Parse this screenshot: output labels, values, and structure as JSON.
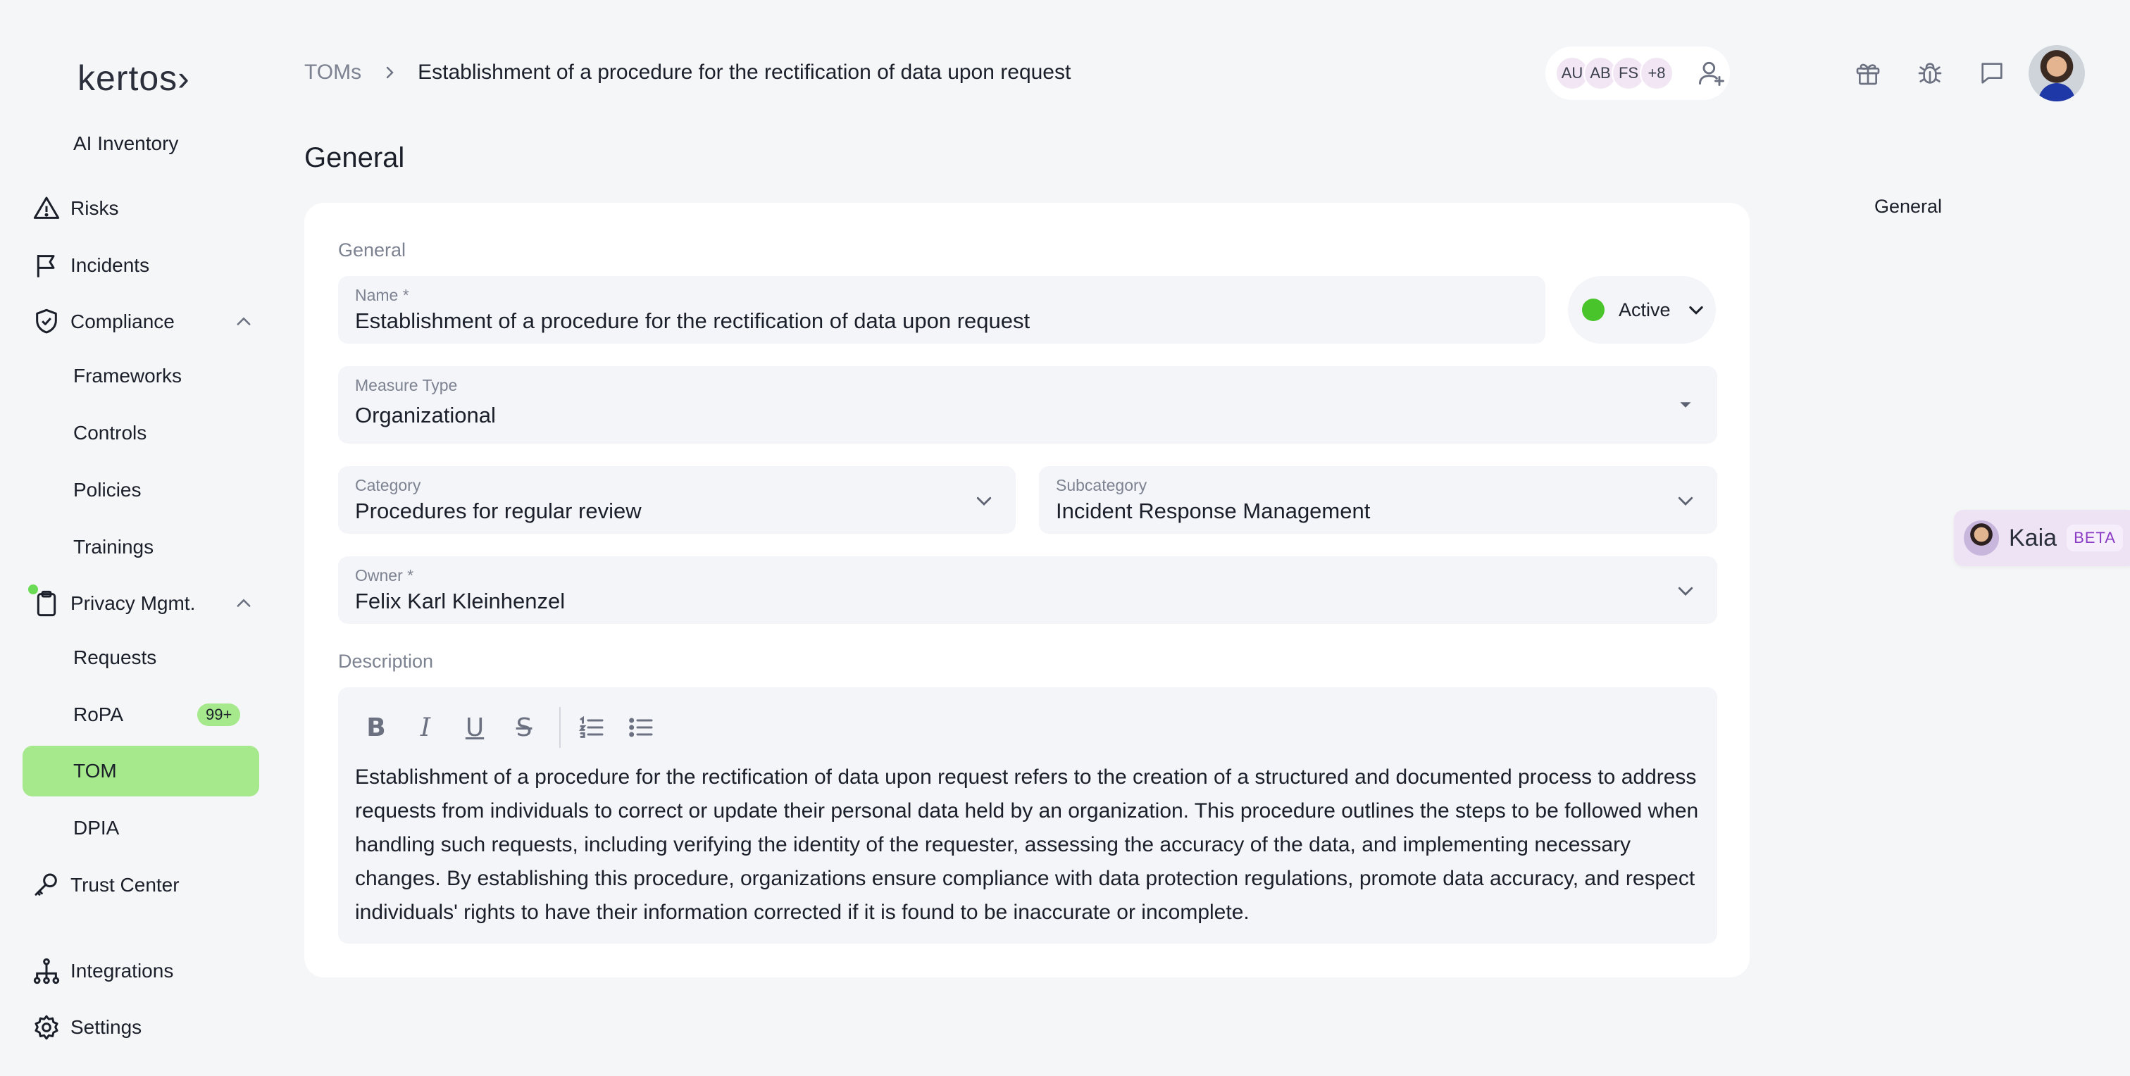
{
  "app": {
    "logo": "kertos",
    "logo_arrow": "›"
  },
  "sidebar": {
    "items": [
      {
        "label": "AI Inventory",
        "icon": "none"
      },
      {
        "label": "Risks",
        "icon": "warning-triangle-icon"
      },
      {
        "label": "Incidents",
        "icon": "flag-icon"
      },
      {
        "label": "Compliance",
        "icon": "shield-check-icon",
        "expanded": true
      },
      {
        "label": "Frameworks"
      },
      {
        "label": "Controls"
      },
      {
        "label": "Policies"
      },
      {
        "label": "Trainings"
      },
      {
        "label": "Privacy Mgmt.",
        "icon": "clipboard-icon",
        "expanded": true
      },
      {
        "label": "Requests"
      },
      {
        "label": "RoPA",
        "badge": "99+"
      },
      {
        "label": "TOM",
        "active": true
      },
      {
        "label": "DPIA"
      },
      {
        "label": "Trust Center",
        "icon": "key-icon"
      },
      {
        "label": "Integrations",
        "icon": "hierarchy-icon"
      },
      {
        "label": "Settings",
        "icon": "gear-icon"
      }
    ]
  },
  "header": {
    "breadcrumb_parent": "TOMs",
    "breadcrumb_current": "Establishment of a procedure for the rectification of data upon request",
    "collaborators": [
      "AU",
      "AB",
      "FS",
      "+8"
    ],
    "icons": [
      "gift-icon",
      "bug-icon",
      "chat-icon"
    ]
  },
  "main": {
    "page_title": "General",
    "section_general": "General",
    "name_label": "Name *",
    "name_value": "Establishment of a procedure for the rectification of data upon request",
    "status": "Active",
    "status_color": "#49c42a",
    "measure_type_label": "Measure Type",
    "measure_type_value": "Organizational",
    "category_label": "Category",
    "category_value": "Procedures for regular review",
    "subcategory_label": "Subcategory",
    "subcategory_value": "Incident Response Management",
    "owner_label": "Owner *",
    "owner_value": "Felix Karl Kleinhenzel",
    "description_label": "Description",
    "toolbar": {
      "bold": "B",
      "italic": "I",
      "underline": "U",
      "strike": "S"
    },
    "description": "Establishment of a procedure for the rectification of data upon request refers to the creation of a structured and documented process to address requests from individuals to correct or update their personal data held by an organization. This procedure outlines the steps to be followed when handling such requests, including verifying the identity of the requester, assessing the accuracy of the data, and implementing necessary changes. By establishing this procedure, organizations ensure compliance with data protection regulations, promote data accuracy, and respect individuals' rights to have their information corrected if it is found to be inaccurate or incomplete."
  },
  "toc": {
    "item": "General"
  },
  "assistant": {
    "name": "Kaia",
    "tag": "BETA"
  },
  "colors": {
    "accent": "#a6e98c",
    "background": "#f5f6f8",
    "field": "#f4f5f9"
  }
}
